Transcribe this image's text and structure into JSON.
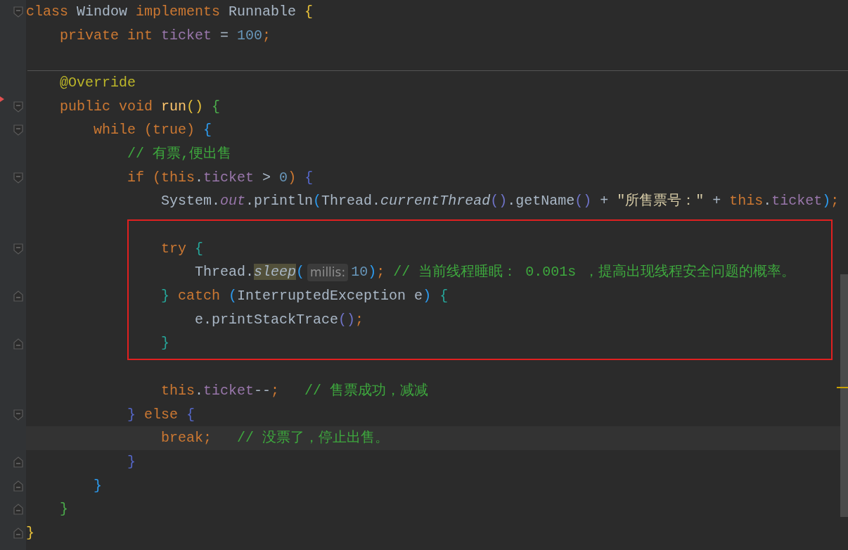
{
  "editor": {
    "lines": [
      {
        "kind": "code",
        "fold_start": true,
        "tokens": [
          {
            "kind": "keyword",
            "text": "class "
          },
          {
            "kind": "plain",
            "text": "Window "
          },
          {
            "kind": "keyword",
            "text": "implements "
          },
          {
            "kind": "plain",
            "text": "Runnable "
          },
          {
            "kind": "bracket",
            "color": "#e8c13a",
            "text": "{"
          }
        ]
      },
      {
        "kind": "code",
        "tokens": [
          {
            "kind": "keyword",
            "text": "    private int "
          },
          {
            "kind": "field",
            "text": "ticket"
          },
          {
            "kind": "plain",
            "text": " = "
          },
          {
            "kind": "number",
            "text": "100"
          },
          {
            "kind": "keyword",
            "text": ";"
          }
        ]
      },
      {
        "kind": "blank",
        "separator": true
      },
      {
        "kind": "code",
        "tokens": [
          {
            "kind": "annotation",
            "text": "    @Override"
          }
        ]
      },
      {
        "kind": "code",
        "fold_start": true,
        "override": true,
        "tokens": [
          {
            "kind": "keyword",
            "text": "    public void "
          },
          {
            "kind": "method",
            "text": "run"
          },
          {
            "kind": "bracket",
            "color": "#e8c13a",
            "text": "()"
          },
          {
            "kind": "bracket",
            "color": "#4cae4c",
            "text": " {"
          }
        ]
      },
      {
        "kind": "code",
        "fold_start": true,
        "tokens": [
          {
            "kind": "keyword",
            "text": "        while "
          },
          {
            "kind": "bracket",
            "color": "#cc7832",
            "text": "("
          },
          {
            "kind": "keyword",
            "text": "true"
          },
          {
            "kind": "bracket",
            "color": "#cc7832",
            "text": ")"
          },
          {
            "kind": "bracket",
            "color": "#2d9cf0",
            "text": " {"
          }
        ]
      },
      {
        "kind": "code",
        "tokens": [
          {
            "kind": "comment",
            "text": "            // 有票,便出售"
          }
        ]
      },
      {
        "kind": "code",
        "fold_start": true,
        "tokens": [
          {
            "kind": "keyword",
            "text": "            if "
          },
          {
            "kind": "bracket",
            "color": "#cc7832",
            "text": "("
          },
          {
            "kind": "keyword",
            "text": "this"
          },
          {
            "kind": "plain",
            "text": "."
          },
          {
            "kind": "field",
            "text": "ticket"
          },
          {
            "kind": "plain",
            "text": " > "
          },
          {
            "kind": "number",
            "text": "0"
          },
          {
            "kind": "bracket",
            "color": "#cc7832",
            "text": ")"
          },
          {
            "kind": "bracket",
            "color": "#5567c9",
            "text": " {"
          }
        ]
      },
      {
        "kind": "code",
        "tokens": [
          {
            "kind": "plain",
            "text": "                System."
          },
          {
            "kind": "static-field",
            "text": "out"
          },
          {
            "kind": "plain",
            "text": ".println"
          },
          {
            "kind": "bracket",
            "color": "#2d9cf0",
            "text": "("
          },
          {
            "kind": "plain",
            "text": "Thread."
          },
          {
            "kind": "static-call",
            "text": "currentThread"
          },
          {
            "kind": "bracket",
            "color": "#6f73c8",
            "text": "()"
          },
          {
            "kind": "plain",
            "text": ".getName"
          },
          {
            "kind": "bracket",
            "color": "#6f73c8",
            "text": "()"
          },
          {
            "kind": "plain",
            "text": " + "
          },
          {
            "kind": "string",
            "text": "\"所售票号：\""
          },
          {
            "kind": "plain",
            "text": " + "
          },
          {
            "kind": "keyword",
            "text": "this"
          },
          {
            "kind": "plain",
            "text": "."
          },
          {
            "kind": "field",
            "text": "ticket"
          },
          {
            "kind": "bracket",
            "color": "#2d9cf0",
            "text": ")"
          },
          {
            "kind": "keyword",
            "text": ";"
          }
        ]
      },
      {
        "kind": "blank"
      },
      {
        "kind": "code",
        "fold_start": true,
        "tokens": [
          {
            "kind": "keyword",
            "text": "                try "
          },
          {
            "kind": "bracket",
            "color": "#26a69a",
            "text": "{"
          }
        ]
      },
      {
        "kind": "code",
        "tokens": [
          {
            "kind": "plain",
            "text": "                    Thread."
          },
          {
            "kind": "static-call-highlighted",
            "text": "sleep"
          },
          {
            "kind": "bracket",
            "color": "#2d9cf0",
            "text": "("
          },
          {
            "kind": "hint",
            "text": "millis:"
          },
          {
            "kind": "number",
            "text": "10"
          },
          {
            "kind": "bracket",
            "color": "#2d9cf0",
            "text": ")"
          },
          {
            "kind": "keyword",
            "text": "; "
          },
          {
            "kind": "comment",
            "text": "// 当前线程睡眠： 0.001s ，提高出现线程安全问题的概率。"
          }
        ]
      },
      {
        "kind": "code",
        "fold_end": true,
        "tokens": [
          {
            "kind": "bracket",
            "color": "#26a69a",
            "text": "                }"
          },
          {
            "kind": "keyword",
            "text": " catch "
          },
          {
            "kind": "bracket",
            "color": "#2d9cf0",
            "text": "("
          },
          {
            "kind": "plain",
            "text": "InterruptedException e"
          },
          {
            "kind": "bracket",
            "color": "#2d9cf0",
            "text": ")"
          },
          {
            "kind": "bracket",
            "color": "#26a69a",
            "text": " {"
          }
        ]
      },
      {
        "kind": "code",
        "tokens": [
          {
            "kind": "plain",
            "text": "                    e.printStackTrace"
          },
          {
            "kind": "bracket",
            "color": "#6f73c8",
            "text": "()"
          },
          {
            "kind": "keyword",
            "text": ";"
          }
        ]
      },
      {
        "kind": "code",
        "fold_end": true,
        "tokens": [
          {
            "kind": "bracket",
            "color": "#26a69a",
            "text": "                }"
          }
        ]
      },
      {
        "kind": "blank"
      },
      {
        "kind": "code",
        "tokens": [
          {
            "kind": "keyword",
            "text": "                this"
          },
          {
            "kind": "plain",
            "text": "."
          },
          {
            "kind": "field",
            "text": "ticket"
          },
          {
            "kind": "plain",
            "text": "--"
          },
          {
            "kind": "keyword",
            "text": ";   "
          },
          {
            "kind": "comment",
            "text": "// 售票成功，减减"
          }
        ]
      },
      {
        "kind": "code",
        "fold_start": true,
        "tokens": [
          {
            "kind": "bracket",
            "color": "#5567c9",
            "text": "            }"
          },
          {
            "kind": "keyword",
            "text": " else "
          },
          {
            "kind": "bracket",
            "color": "#5567c9",
            "text": "{"
          }
        ]
      },
      {
        "kind": "code",
        "current": true,
        "tokens": [
          {
            "kind": "keyword",
            "text": "                break;   "
          },
          {
            "kind": "comment",
            "text": "// 没票了，停止出售。"
          }
        ]
      },
      {
        "kind": "code",
        "fold_end": true,
        "tokens": [
          {
            "kind": "bracket",
            "color": "#5567c9",
            "text": "            }"
          }
        ]
      },
      {
        "kind": "code",
        "fold_end": true,
        "tokens": [
          {
            "kind": "bracket",
            "color": "#2d9cf0",
            "text": "        }"
          }
        ]
      },
      {
        "kind": "code",
        "fold_end": true,
        "tokens": [
          {
            "kind": "bracket",
            "color": "#4cae4c",
            "text": "    }"
          }
        ]
      },
      {
        "kind": "code",
        "fold_end": true,
        "tokens": [
          {
            "kind": "bracket",
            "color": "#e8c13a",
            "text": "}"
          }
        ]
      }
    ]
  }
}
